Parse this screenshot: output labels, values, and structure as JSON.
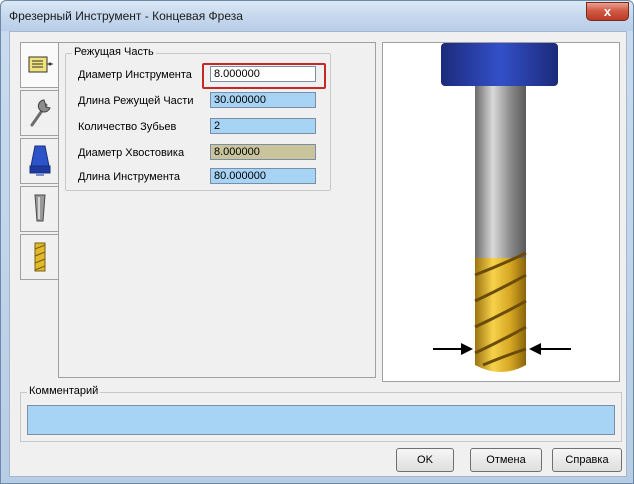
{
  "window": {
    "title": "Фрезерный Инструмент - Концевая Фреза",
    "close_glyph": "x"
  },
  "tabs": [
    {
      "icon": "parameters-icon",
      "selected": true
    },
    {
      "icon": "wrench-icon",
      "selected": false
    },
    {
      "icon": "holder-cone-icon",
      "selected": false
    },
    {
      "icon": "shank-icon",
      "selected": false
    },
    {
      "icon": "cutter-icon",
      "selected": false
    }
  ],
  "cutting_part": {
    "title": "Режущая Часть",
    "fields": [
      {
        "label": "Диаметр Инструмента",
        "value": "8.000000"
      },
      {
        "label": "Длина Режущей Части",
        "value": "30.000000"
      },
      {
        "label": "Количество Зубьев",
        "value": "2"
      },
      {
        "label": "Диаметр Хвостовика",
        "value": "8.000000"
      },
      {
        "label": "Длина Инструмента",
        "value": "80.000000"
      }
    ]
  },
  "comment": {
    "title": "Комментарий",
    "value": ""
  },
  "buttons": {
    "ok": "OK",
    "cancel": "Отмена",
    "help": "Справка"
  },
  "colors": {
    "field_fill": "#a7d3f5",
    "shank_field_fill": "#c9c49b",
    "highlight": "#c62828"
  }
}
